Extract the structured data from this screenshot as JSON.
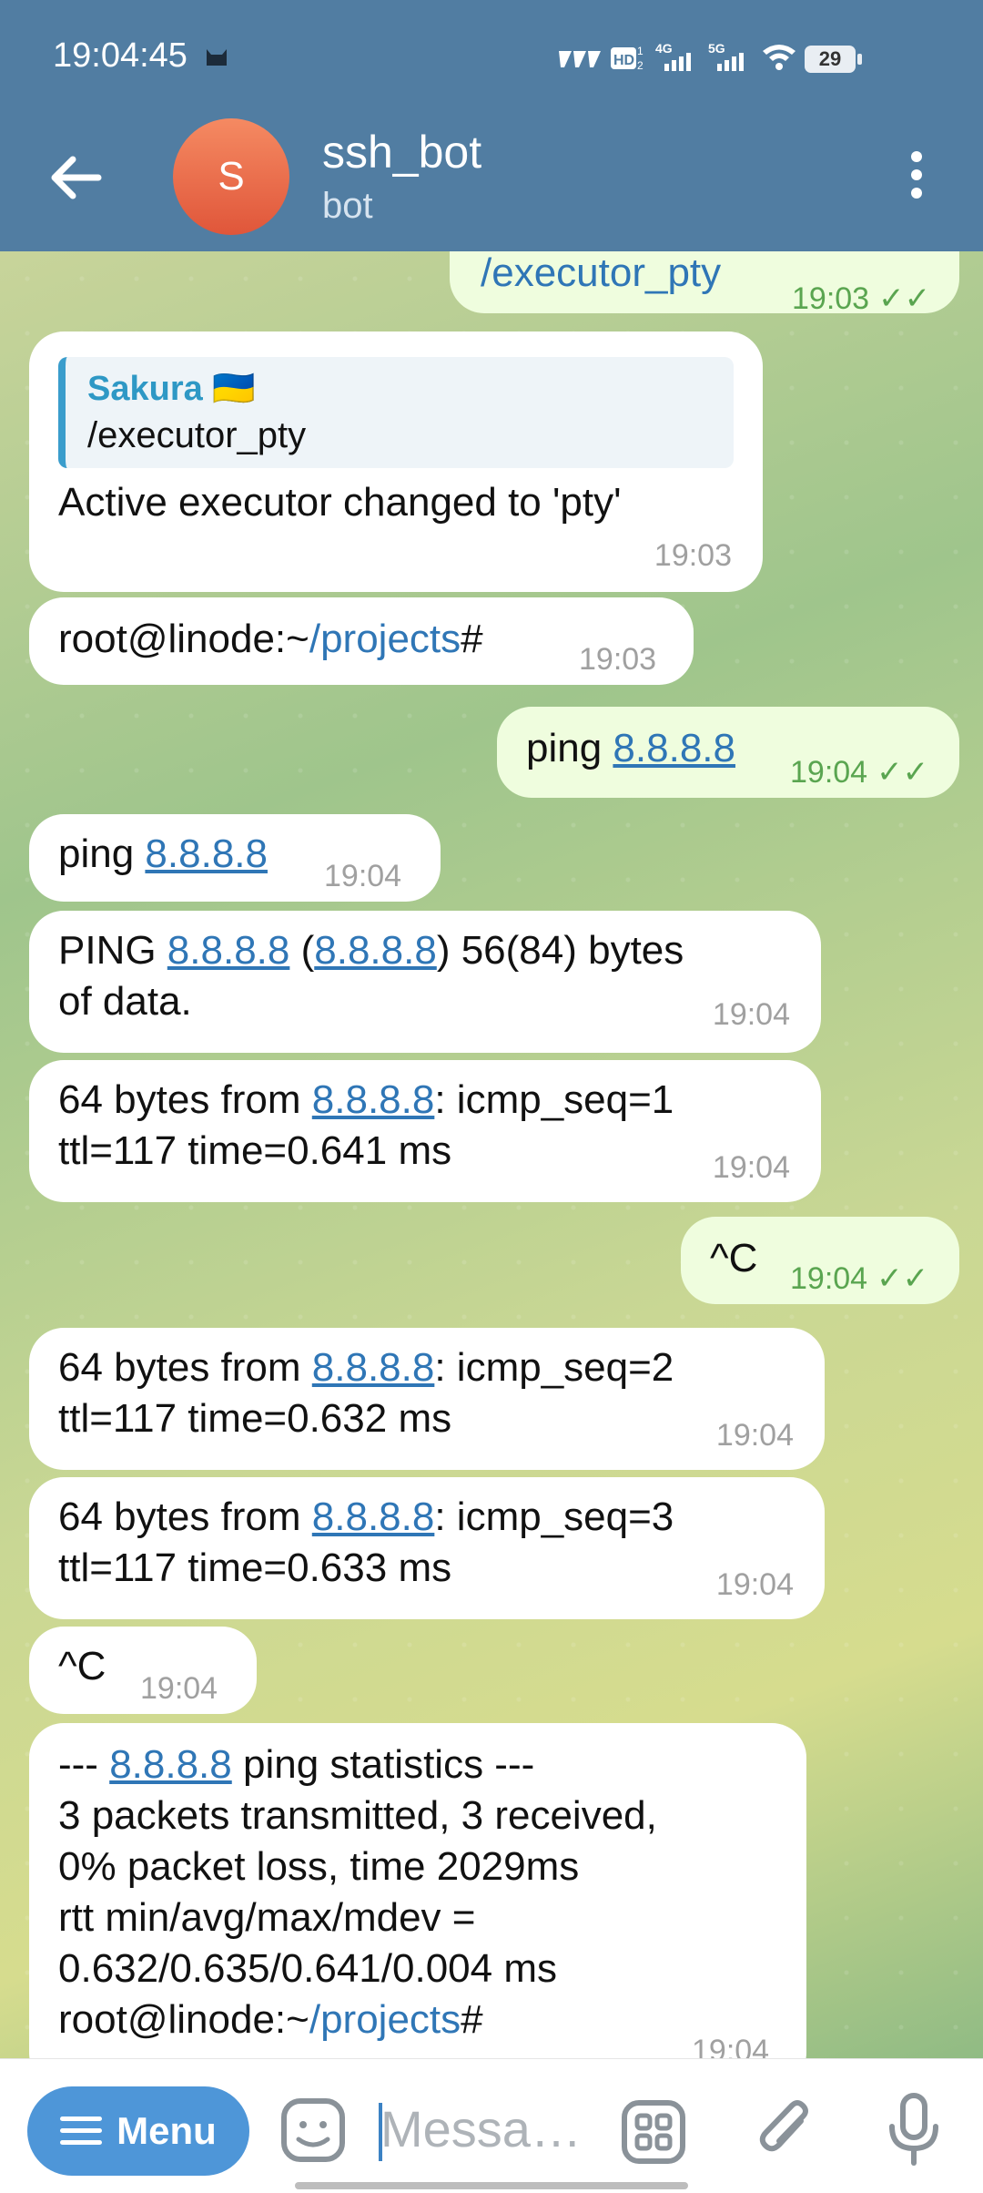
{
  "status_bar": {
    "time": "19:04:45",
    "icons": [
      "cat-icon",
      "hd-icon",
      "4g-signal-icon",
      "5g-signal-icon",
      "wifi-icon"
    ],
    "battery": "29"
  },
  "header": {
    "avatar_letter": "S",
    "title": "ssh_bot",
    "subtitle": "bot"
  },
  "messages": {
    "m1": {
      "text": "/executor_pty",
      "time": "19:03"
    },
    "m2": {
      "reply_name": "Sakura 🇺🇦",
      "reply_text": "/executor_pty",
      "text": "Active executor changed to 'pty'",
      "time": "19:03"
    },
    "m3": {
      "prefix": "root@linode:~",
      "path": "/projects",
      "suffix": "#",
      "time": "19:03"
    },
    "m4": {
      "prefix": "ping ",
      "link": "8.8.8.8",
      "time": "19:04"
    },
    "m5": {
      "prefix": "ping ",
      "link": "8.8.8.8",
      "time": "19:04"
    },
    "m6": {
      "a": "PING ",
      "link1": "8.8.8.8",
      "b": " (",
      "link2": "8.8.8.8",
      "c": ") 56(84) bytes",
      "line2": "of data.",
      "time": "19:04"
    },
    "m7": {
      "a": "64 bytes from ",
      "link": "8.8.8.8",
      "b": ": icmp_seq=1",
      "line2": "ttl=117 time=0.641 ms",
      "time": "19:04"
    },
    "m8": {
      "text": "^C",
      "time": "19:04"
    },
    "m9": {
      "a": "64 bytes from ",
      "link": "8.8.8.8",
      "b": ": icmp_seq=2",
      "line2": "ttl=117 time=0.632 ms",
      "time": "19:04"
    },
    "m10": {
      "a": "64 bytes from ",
      "link": "8.8.8.8",
      "b": ": icmp_seq=3",
      "line2": "ttl=117 time=0.633 ms",
      "time": "19:04"
    },
    "m11": {
      "text": "^C",
      "time": "19:04"
    },
    "m12": {
      "a": "--- ",
      "link": "8.8.8.8",
      "b": " ping statistics ---",
      "line2": "3 packets transmitted, 3 received,",
      "line3": "0% packet loss, time 2029ms",
      "line4": "rtt min/avg/max/mdev =",
      "line5": "0.632/0.635/0.641/0.004 ms",
      "prefix": "root@linode:~",
      "path": "/projects",
      "suffix": "#",
      "time": "19:04"
    }
  },
  "input": {
    "menu_label": "Menu",
    "placeholder": "Messa…"
  },
  "colors": {
    "header": "#517da2",
    "outgoing_bubble": "#effdde",
    "incoming_bubble": "#ffffff",
    "link": "#2f76b6",
    "menu_button": "#4e96d8"
  }
}
